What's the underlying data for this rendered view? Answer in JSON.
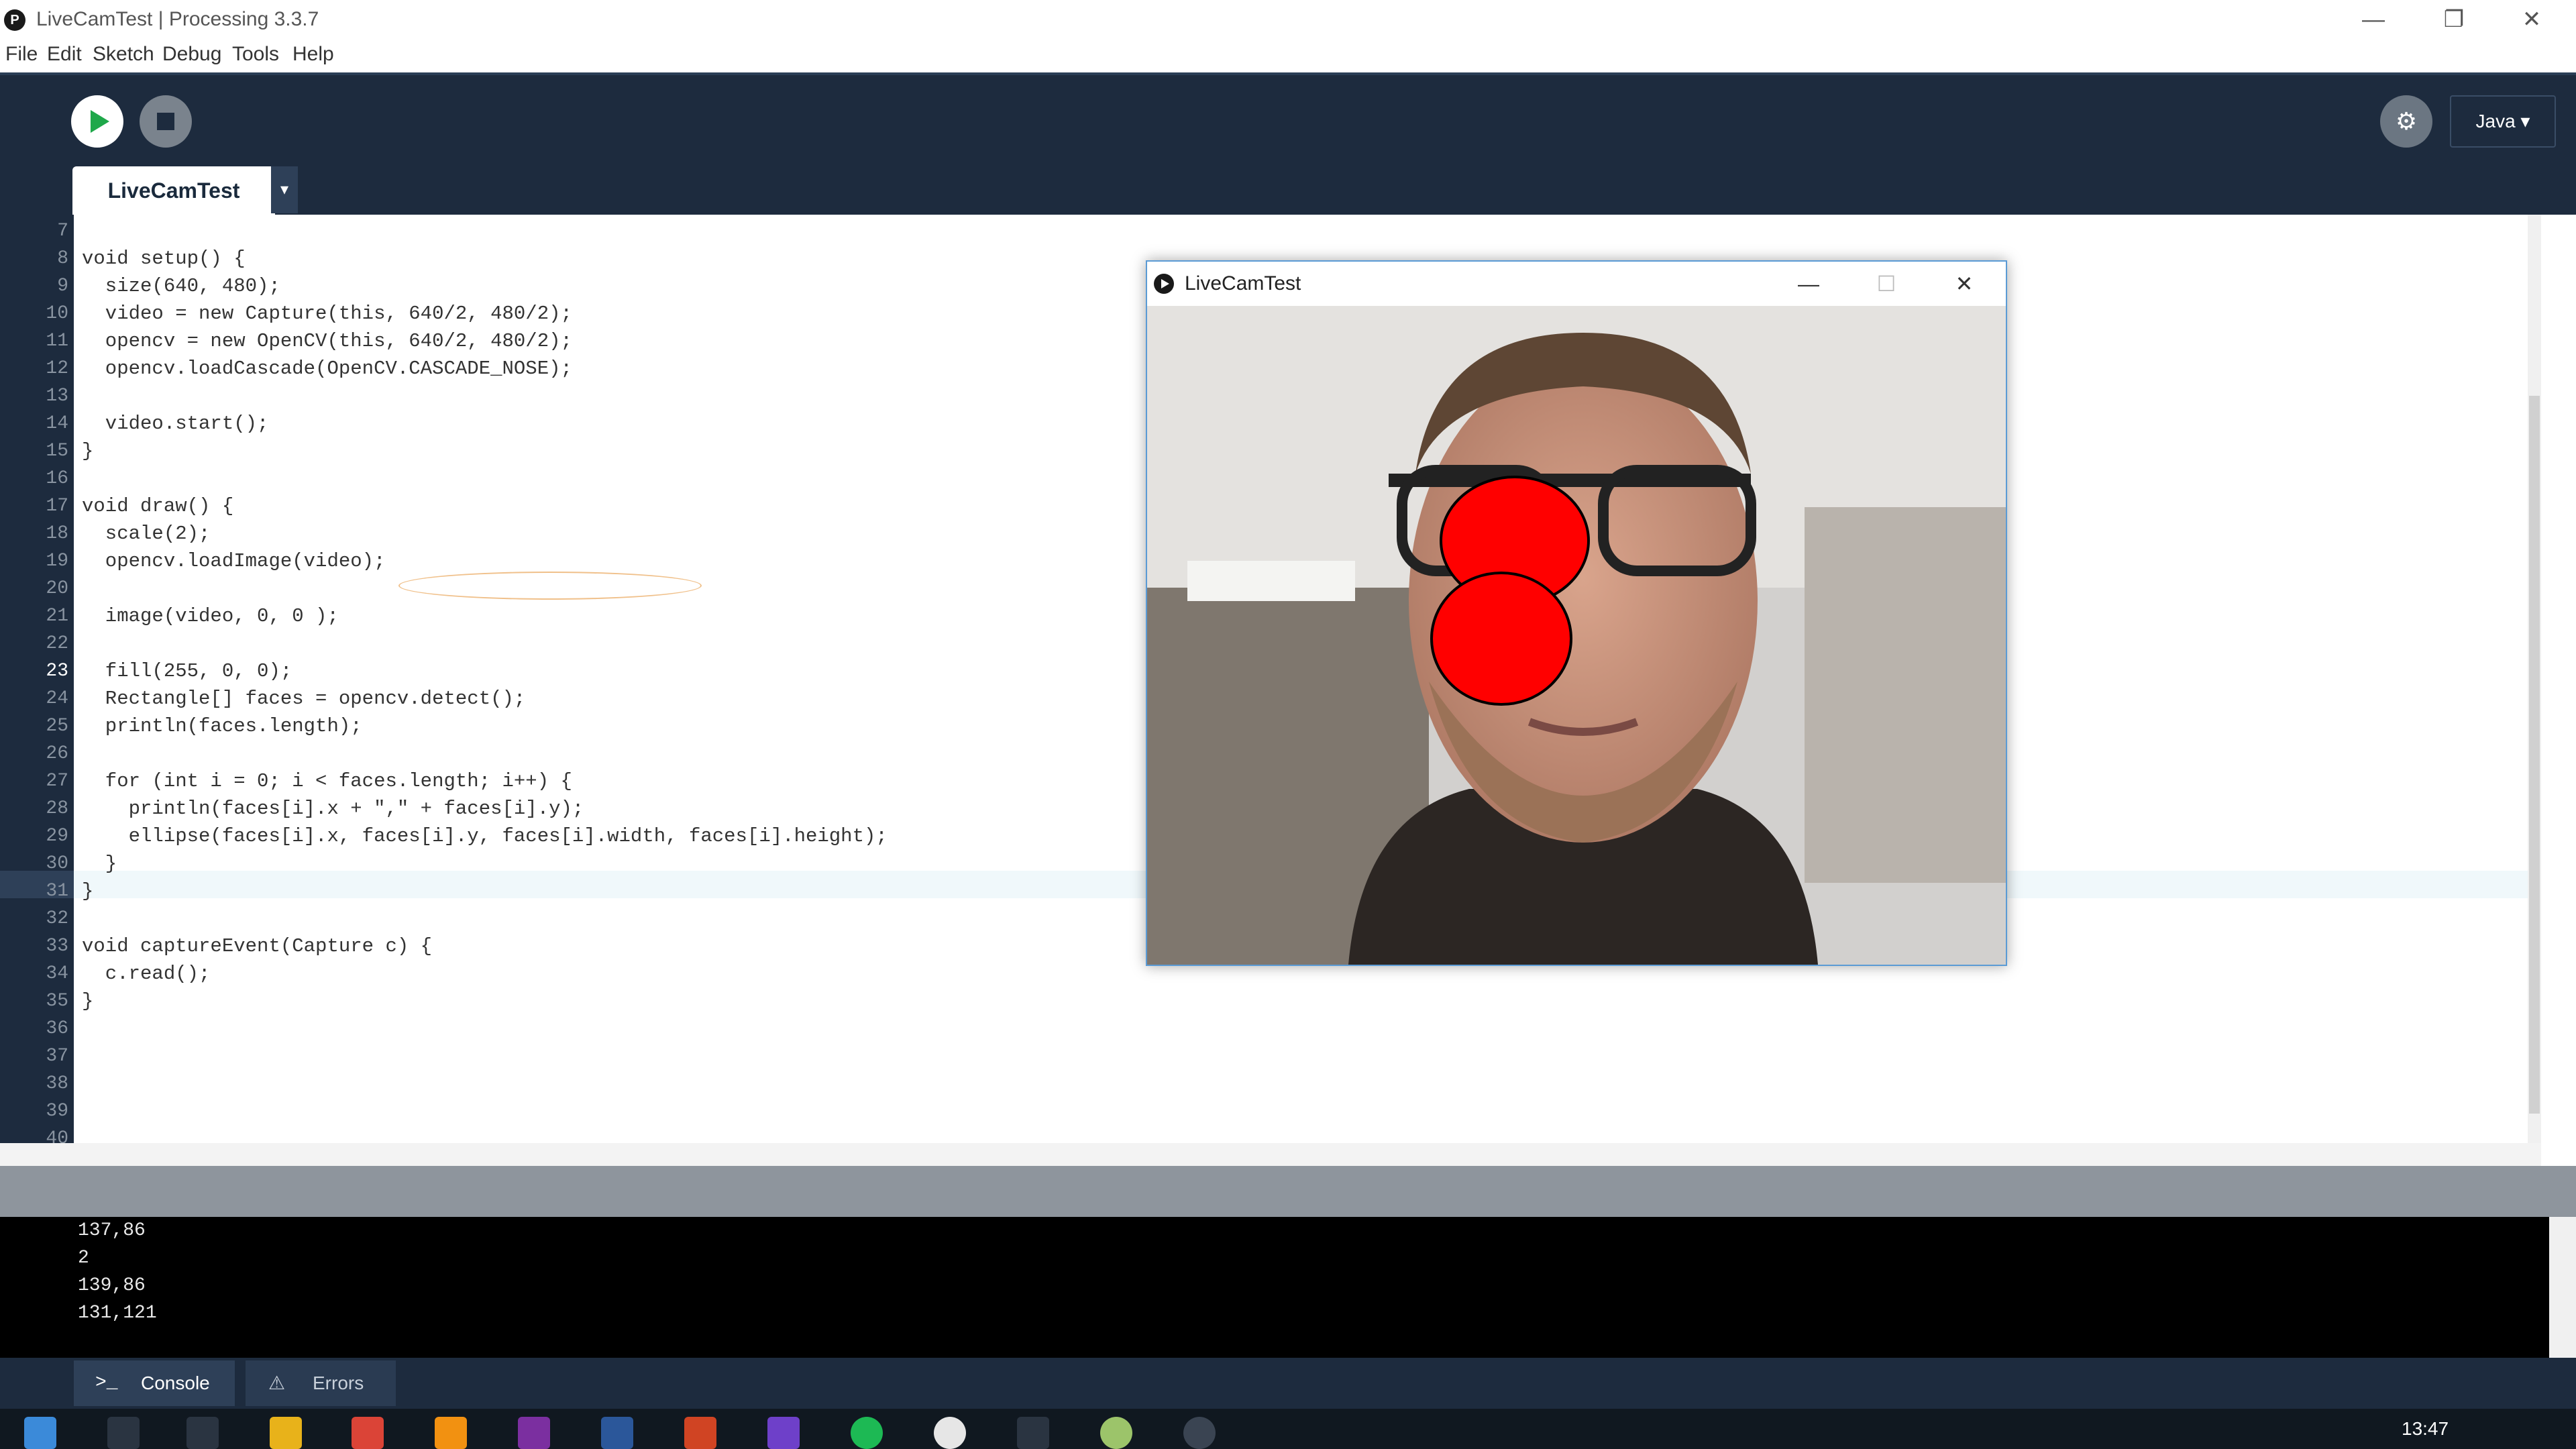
{
  "window": {
    "title": "LiveCamTest | Processing 3.3.7",
    "controls": {
      "minimize": "—",
      "restore": "❐",
      "close": "✕"
    }
  },
  "menu": [
    "File",
    "Edit",
    "Sketch",
    "Debug",
    "Tools",
    "Help"
  ],
  "toolbar": {
    "mode_label": "Java ▾",
    "debug_icon": "debugger-icon"
  },
  "tabs": {
    "main": "LiveCamTest",
    "arrow": "▾"
  },
  "editor": {
    "line_numbers": [
      "7",
      "8",
      "9",
      "10",
      "11",
      "12",
      "13",
      "14",
      "15",
      "16",
      "17",
      "18",
      "19",
      "20",
      "21",
      "22",
      "23",
      "24",
      "25",
      "26",
      "27",
      "28",
      "29",
      "30",
      "31",
      "32",
      "33",
      "34",
      "35",
      "36",
      "37",
      "38",
      "39",
      "40"
    ],
    "current_line": "23",
    "code": {
      "l8": "void setup() {",
      "l9": "  size(640, 480);",
      "l10": "  video = new Capture(this, 640/2, 480/2);",
      "l11": "  opencv = new OpenCV(this, 640/2, 480/2);",
      "l12": "  opencv.loadCascade(OpenCV.CASCADE_NOSE);",
      "l14": "  video.start();",
      "l15": "}",
      "l17": "void draw() {",
      "l18": "  scale(2);",
      "l19": "  opencv.loadImage(video);",
      "l21": "  image(video, 0, 0 );",
      "l23": "  fill(255, 0, 0);",
      "l24": "  Rectangle[] faces = opencv.detect();",
      "l25": "  println(faces.length);",
      "l27": "  for (int i = 0; i < faces.length; i++) {",
      "l28": "    println(faces[i].x + \",\" + faces[i].y);",
      "l29": "    ellipse(faces[i].x, faces[i].y, faces[i].width, faces[i].height);",
      "l30": "  }",
      "l31": "}",
      "l33": "void captureEvent(Capture c) {",
      "l34": "  c.read();",
      "l35": "}"
    }
  },
  "console": {
    "lines": [
      "137,86",
      "2",
      "139,86",
      "131,121"
    ],
    "tabs": {
      "console": "Console",
      "errors": "Errors"
    }
  },
  "sketch_window": {
    "title": "LiveCamTest",
    "controls": {
      "minimize": "—",
      "maximize": "☐",
      "close": "✕"
    },
    "fill_color": "#ff0000"
  },
  "taskbar": {
    "clock": "13:47"
  },
  "colors": {
    "toolbar_bg": "#1d2b3e",
    "run_green": "#1fa84a",
    "editor_bg": "#ffffff"
  }
}
